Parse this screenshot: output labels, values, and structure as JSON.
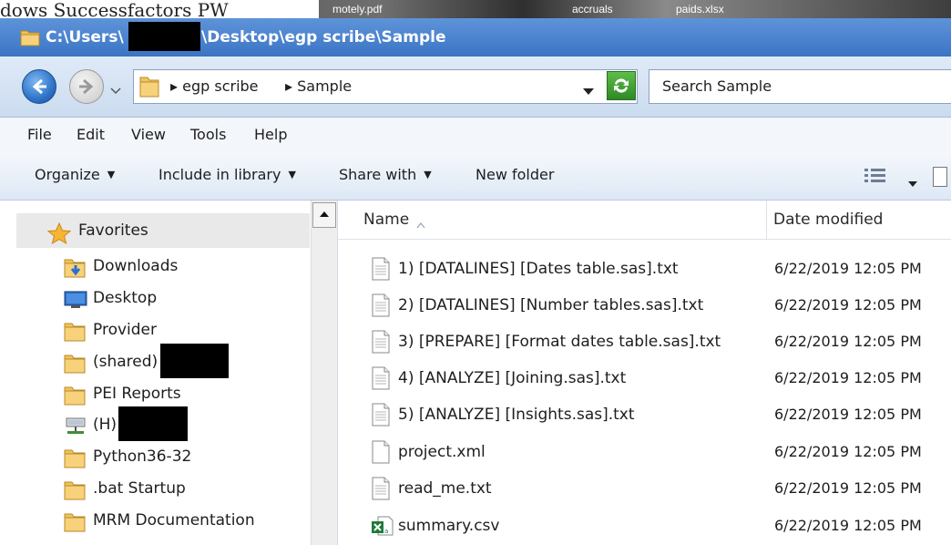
{
  "background_window": {
    "items": [
      "dows  Successfactors PW",
      "motely.pdf",
      "accruals",
      "paids.xlsx"
    ]
  },
  "window": {
    "title_prefix": "C:\\Users\\",
    "title_suffix": "\\Desktop\\egp scribe\\Sample"
  },
  "address": {
    "breadcrumbs": [
      "egp scribe",
      "Sample"
    ],
    "search_placeholder": "Search Sample"
  },
  "menu": [
    "File",
    "Edit",
    "View",
    "Tools",
    "Help"
  ],
  "toolbar": {
    "organize": "Organize",
    "include_in_library": "Include in library",
    "share_with": "Share with",
    "new_folder": "New folder"
  },
  "nav_pane": {
    "favorites": "Favorites",
    "items": [
      {
        "label": "Downloads",
        "icon": "downloads-folder-icon"
      },
      {
        "label": "Desktop",
        "icon": "desktop-icon"
      },
      {
        "label": "Provider",
        "icon": "folder-icon"
      },
      {
        "label": "(shared)",
        "icon": "folder-icon"
      },
      {
        "label": "PEI Reports",
        "icon": "folder-icon"
      },
      {
        "label": "(H)",
        "icon": "network-drive-icon"
      },
      {
        "label": "Python36-32",
        "icon": "folder-icon"
      },
      {
        "label": ".bat Startup",
        "icon": "folder-icon"
      },
      {
        "label": "MRM Documentation",
        "icon": "folder-icon"
      }
    ]
  },
  "file_list": {
    "columns": {
      "name": "Name",
      "date": "Date modified"
    },
    "files": [
      {
        "name": "1) [DATALINES] [Dates table.sas].txt",
        "date": "6/22/2019 12:05 PM",
        "icon": "text-file-icon"
      },
      {
        "name": "2) [DATALINES] [Number tables.sas].txt",
        "date": "6/22/2019 12:05 PM",
        "icon": "text-file-icon"
      },
      {
        "name": "3) [PREPARE] [Format dates table.sas].txt",
        "date": "6/22/2019 12:05 PM",
        "icon": "text-file-icon"
      },
      {
        "name": "4) [ANALYZE] [Joining.sas].txt",
        "date": "6/22/2019 12:05 PM",
        "icon": "text-file-icon"
      },
      {
        "name": "5) [ANALYZE] [Insights.sas].txt",
        "date": "6/22/2019 12:05 PM",
        "icon": "text-file-icon"
      },
      {
        "name": "project.xml",
        "date": "6/22/2019 12:05 PM",
        "icon": "xml-file-icon"
      },
      {
        "name": "read_me.txt",
        "date": "6/22/2019 12:05 PM",
        "icon": "text-file-icon"
      },
      {
        "name": "summary.csv",
        "date": "6/22/2019 12:05 PM",
        "icon": "excel-csv-icon"
      }
    ]
  },
  "colors": {
    "titlebar": "#4f86d1",
    "selection": "#e9e9e9",
    "folder": "#e8b84a"
  }
}
